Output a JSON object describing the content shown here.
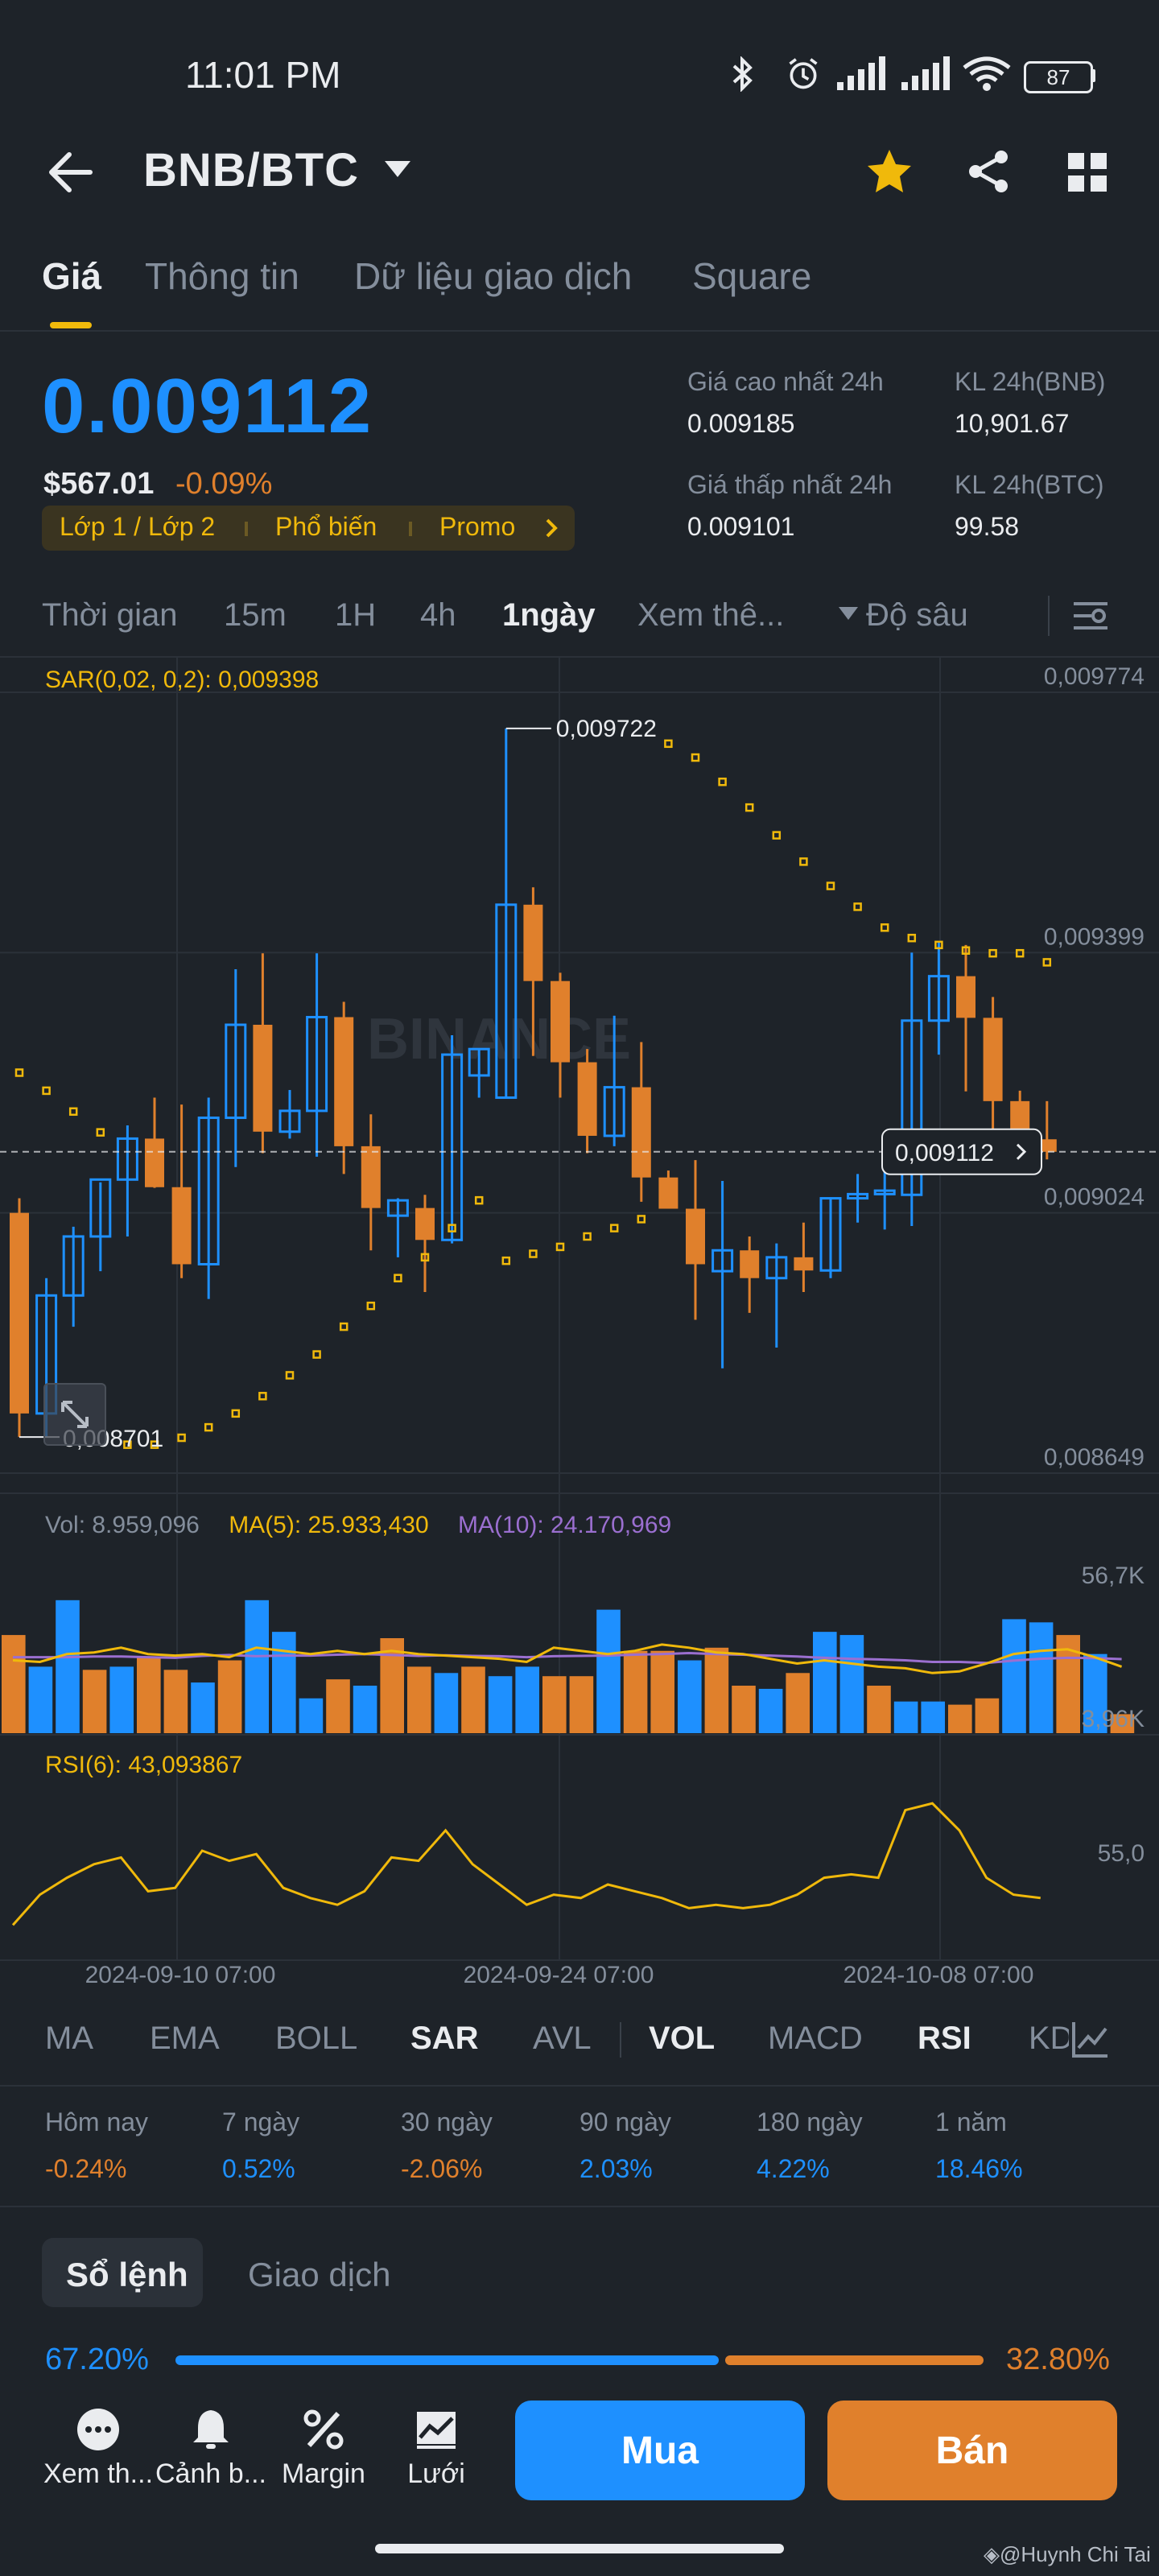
{
  "status_bar": {
    "time": "11:01 PM",
    "battery": "87"
  },
  "header": {
    "pair": "BNB/BTC"
  },
  "tabs": [
    "Giá",
    "Thông tin",
    "Dữ liệu giao dịch",
    "Square"
  ],
  "price": {
    "last": "0.009112",
    "usd": "$567.01",
    "change": "-0.09%",
    "tags": [
      "Lớp 1 / Lớp 2",
      "Phổ biến",
      "Promo"
    ],
    "high_label": "Giá cao nhất 24h",
    "high_value": "0.009185",
    "low_label": "Giá thấp nhất 24h",
    "low_value": "0.009101",
    "vol_bnb_label": "KL 24h(BNB)",
    "vol_bnb_value": "10,901.67",
    "vol_btc_label": "KL 24h(BTC)",
    "vol_btc_value": "99.58"
  },
  "timeframes": [
    "Thời gian",
    "15m",
    "1H",
    "4h",
    "1ngày",
    "Xem thê...",
    "Độ sâu"
  ],
  "chart": {
    "sar_label": "SAR(0,02, 0,2): 0,009398",
    "vol_label": "Vol: 8.959,096",
    "ma5_label": "MA(5): 25.933,430",
    "ma10_label": "MA(10): 24.170,969",
    "rsi_label": "RSI(6): 43,093867",
    "price_axis": [
      "0,009774",
      "0,009399",
      "0,009024",
      "0,008649"
    ],
    "vol_axis": [
      "56,7K",
      "3,96K"
    ],
    "rsi_axis": [
      "55,0"
    ],
    "date_axis": [
      "2024-09-10 07:00",
      "2024-09-24 07:00",
      "2024-10-08 07:00"
    ],
    "max_label": "0,009722",
    "min_label": "0,008701",
    "last_label": "0,009112",
    "watermark": "BINANCE"
  },
  "chart_data": {
    "type": "candlestick",
    "y_range": [
      0.008649,
      0.009774
    ],
    "colors": {
      "up": "#1e90ff",
      "down": "#e0802c",
      "sar": "#f0b90b",
      "ma5": "#f0b90b",
      "ma10": "#9b6fd0"
    },
    "candles": [
      {
        "o": 0.009024,
        "h": 0.009045,
        "l": 0.008701,
        "c": 0.008735
      },
      {
        "o": 0.008735,
        "h": 0.00893,
        "l": 0.0087,
        "c": 0.008905
      },
      {
        "o": 0.008905,
        "h": 0.009004,
        "l": 0.00886,
        "c": 0.00899
      },
      {
        "o": 0.00899,
        "h": 0.009068,
        "l": 0.00894,
        "c": 0.009072
      },
      {
        "o": 0.009072,
        "h": 0.00915,
        "l": 0.00899,
        "c": 0.009131
      },
      {
        "o": 0.009131,
        "h": 0.00919,
        "l": 0.00906,
        "c": 0.009061
      },
      {
        "o": 0.009061,
        "h": 0.00918,
        "l": 0.00893,
        "c": 0.00895
      },
      {
        "o": 0.00895,
        "h": 0.00919,
        "l": 0.0089,
        "c": 0.009161
      },
      {
        "o": 0.009161,
        "h": 0.009375,
        "l": 0.00909,
        "c": 0.009295
      },
      {
        "o": 0.009295,
        "h": 0.009398,
        "l": 0.00911,
        "c": 0.009141
      },
      {
        "o": 0.009141,
        "h": 0.009201,
        "l": 0.009131,
        "c": 0.009171
      },
      {
        "o": 0.009171,
        "h": 0.009398,
        "l": 0.009105,
        "c": 0.009306
      },
      {
        "o": 0.009306,
        "h": 0.009328,
        "l": 0.00908,
        "c": 0.00912
      },
      {
        "o": 0.00912,
        "h": 0.009166,
        "l": 0.00897,
        "c": 0.009031
      },
      {
        "o": 0.00902,
        "h": 0.009045,
        "l": 0.00896,
        "c": 0.009042
      },
      {
        "o": 0.009031,
        "h": 0.00905,
        "l": 0.00891,
        "c": 0.008985
      },
      {
        "o": 0.008985,
        "h": 0.00928,
        "l": 0.00898,
        "c": 0.009252
      },
      {
        "o": 0.009222,
        "h": 0.00926,
        "l": 0.00919,
        "c": 0.00926
      },
      {
        "o": 0.00919,
        "h": 0.009722,
        "l": 0.00919,
        "c": 0.009468
      },
      {
        "o": 0.009468,
        "h": 0.009493,
        "l": 0.00925,
        "c": 0.009358
      },
      {
        "o": 0.009358,
        "h": 0.00937,
        "l": 0.00919,
        "c": 0.009241
      },
      {
        "o": 0.009241,
        "h": 0.00926,
        "l": 0.00911,
        "c": 0.009135
      },
      {
        "o": 0.009135,
        "h": 0.009308,
        "l": 0.00912,
        "c": 0.009205
      },
      {
        "o": 0.009205,
        "h": 0.00927,
        "l": 0.00904,
        "c": 0.009075
      },
      {
        "o": 0.009075,
        "h": 0.009085,
        "l": 0.00903,
        "c": 0.00903
      },
      {
        "o": 0.00903,
        "h": 0.0091,
        "l": 0.00887,
        "c": 0.00895
      },
      {
        "o": 0.00894,
        "h": 0.00907,
        "l": 0.0088,
        "c": 0.00897
      },
      {
        "o": 0.00897,
        "h": 0.00899,
        "l": 0.00888,
        "c": 0.00893
      },
      {
        "o": 0.00893,
        "h": 0.00898,
        "l": 0.00883,
        "c": 0.00896
      },
      {
        "o": 0.00896,
        "h": 0.00901,
        "l": 0.00891,
        "c": 0.008941
      },
      {
        "o": 0.008941,
        "h": 0.009045,
        "l": 0.00893,
        "c": 0.009045
      },
      {
        "o": 0.009045,
        "h": 0.00908,
        "l": 0.00901,
        "c": 0.009051
      },
      {
        "o": 0.009051,
        "h": 0.00909,
        "l": 0.009,
        "c": 0.009056
      },
      {
        "o": 0.00905,
        "h": 0.009399,
        "l": 0.009005,
        "c": 0.009301
      },
      {
        "o": 0.009301,
        "h": 0.009415,
        "l": 0.009252,
        "c": 0.009365
      },
      {
        "o": 0.009365,
        "h": 0.00941,
        "l": 0.009199,
        "c": 0.009305
      },
      {
        "o": 0.009305,
        "h": 0.009335,
        "l": 0.00913,
        "c": 0.009185
      },
      {
        "o": 0.009185,
        "h": 0.0092,
        "l": 0.009101,
        "c": 0.00913
      },
      {
        "o": 0.00913,
        "h": 0.009185,
        "l": 0.009101,
        "c": 0.009112
      }
    ],
    "sar": [
      0.009226,
      0.0092,
      0.00917,
      0.00914,
      0.00869,
      0.00869,
      0.0087,
      0.008715,
      0.008735,
      0.00876,
      0.00879,
      0.00882,
      0.00886,
      0.00889,
      0.00893,
      0.00896,
      0.009002,
      0.009042,
      0.008955,
      0.008965,
      0.008975,
      0.00899,
      0.009002,
      0.009015,
      0.0097,
      0.00968,
      0.009645,
      0.009608,
      0.009568,
      0.00953,
      0.009495,
      0.009465,
      0.009435,
      0.00942,
      0.00941,
      0.009402,
      0.009398,
      0.009398,
      0.009385
    ],
    "volume": [
      31000,
      21000,
      42000,
      20000,
      21000,
      24000,
      20000,
      16000,
      23000,
      42000,
      32000,
      11000,
      17000,
      15000,
      30000,
      21000,
      19000,
      21000,
      18000,
      21000,
      18000,
      18000,
      39000,
      26000,
      26000,
      23000,
      27000,
      15000,
      14000,
      19000,
      32000,
      31000,
      15000,
      10000,
      10000,
      9000,
      11000,
      36000,
      35000,
      31000,
      25000,
      6000
    ],
    "ma5": [
      23000,
      22500,
      25000,
      25500,
      27000,
      25000,
      24500,
      25000,
      24000,
      27000,
      26000,
      25000,
      26000,
      25000,
      26000,
      25000,
      24500,
      24000,
      23500,
      22500,
      27000,
      26000,
      25000,
      26000,
      28000,
      27000,
      25500,
      25000,
      23500,
      22000,
      23000,
      22000,
      21000,
      20500,
      19000,
      19500,
      22000,
      25000,
      26000,
      26500,
      24000,
      21000
    ],
    "ma10": [
      24000,
      24000,
      24000,
      24200,
      24200,
      24000,
      23800,
      24400,
      24700,
      24300,
      24500,
      24500,
      24800,
      25000,
      24700,
      24400,
      24600,
      24400,
      24300,
      24000,
      24300,
      24400,
      24500,
      24800,
      25000,
      25300,
      25000,
      24800,
      24500,
      24200,
      23800,
      23500,
      23300,
      23000,
      22500,
      22500,
      22200,
      22900,
      23500,
      23800,
      23700,
      23400
    ],
    "rsi": [
      38,
      47,
      52,
      56,
      58,
      48,
      49,
      60,
      57,
      59,
      49,
      46,
      44,
      48,
      58,
      57,
      66,
      56,
      50,
      44,
      47,
      46,
      50,
      48,
      46,
      43,
      44,
      43,
      44,
      47,
      52,
      53,
      52,
      72,
      74,
      66,
      52,
      47,
      46
    ]
  },
  "indicators": {
    "group1": [
      "MA",
      "EMA",
      "BOLL",
      "SAR",
      "AVL"
    ],
    "group2": [
      "VOL",
      "MACD",
      "RSI",
      "KD"
    ],
    "active": [
      "SAR",
      "VOL",
      "RSI"
    ]
  },
  "performance": [
    {
      "label": "Hôm nay",
      "value": "-0.24%"
    },
    {
      "label": "7 ngày",
      "value": "0.52%"
    },
    {
      "label": "30 ngày",
      "value": "-2.06%"
    },
    {
      "label": "90 ngày",
      "value": "2.03%"
    },
    {
      "label": "180 ngày",
      "value": "4.22%"
    },
    {
      "label": "1 năm",
      "value": "18.46%"
    }
  ],
  "orderbook": {
    "tabs": [
      "Sổ lệnh",
      "Giao dịch"
    ],
    "buy_pct": "67.20%",
    "sell_pct": "32.80%",
    "buy_ratio": 0.672
  },
  "bottom_bar": {
    "items": [
      "Xem th...",
      "Cảnh b...",
      "Margin",
      "Lưới"
    ],
    "buy": "Mua",
    "sell": "Bán"
  },
  "credit": "@Huynh Chi Tai"
}
